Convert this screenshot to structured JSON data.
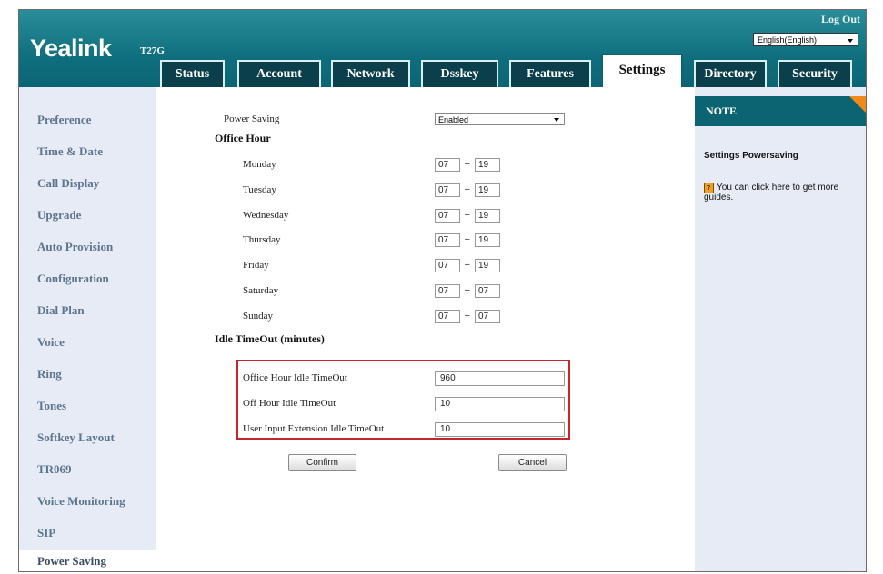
{
  "header": {
    "logo": "Yealink",
    "model": "T27G",
    "logout": "Log Out",
    "language": "English(English)"
  },
  "tabs": [
    {
      "label": "Status"
    },
    {
      "label": "Account"
    },
    {
      "label": "Network"
    },
    {
      "label": "Dsskey"
    },
    {
      "label": "Features"
    },
    {
      "label": "Settings"
    },
    {
      "label": "Directory"
    },
    {
      "label": "Security"
    }
  ],
  "sidebar": {
    "items": [
      {
        "label": "Preference"
      },
      {
        "label": "Time & Date"
      },
      {
        "label": "Call Display"
      },
      {
        "label": "Upgrade"
      },
      {
        "label": "Auto Provision"
      },
      {
        "label": "Configuration"
      },
      {
        "label": "Dial Plan"
      },
      {
        "label": "Voice"
      },
      {
        "label": "Ring"
      },
      {
        "label": "Tones"
      },
      {
        "label": "Softkey Layout"
      },
      {
        "label": "TR069"
      },
      {
        "label": "Voice Monitoring"
      },
      {
        "label": "SIP"
      },
      {
        "label": "Power Saving"
      }
    ]
  },
  "form": {
    "power_saving_label": "Power Saving",
    "power_saving_value": "Enabled",
    "office_hour_heading": "Office Hour",
    "days": [
      {
        "label": "Monday",
        "start": "07",
        "end": "19"
      },
      {
        "label": "Tuesday",
        "start": "07",
        "end": "19"
      },
      {
        "label": "Wednesday",
        "start": "07",
        "end": "19"
      },
      {
        "label": "Thursday",
        "start": "07",
        "end": "19"
      },
      {
        "label": "Friday",
        "start": "07",
        "end": "19"
      },
      {
        "label": "Saturday",
        "start": "07",
        "end": "07"
      },
      {
        "label": "Sunday",
        "start": "07",
        "end": "07"
      }
    ],
    "dash": "–",
    "idle_heading": "Idle TimeOut (minutes)",
    "idle": [
      {
        "label": "Office Hour Idle TimeOut",
        "value": "960"
      },
      {
        "label": "Off Hour Idle TimeOut",
        "value": "10"
      },
      {
        "label": "User Input Extension Idle TimeOut",
        "value": "10"
      }
    ],
    "confirm": "Confirm",
    "cancel": "Cancel"
  },
  "note": {
    "heading": "NOTE",
    "title": "Settings Powersaving",
    "text": "You can click here to get more guides."
  },
  "colors": {
    "header_teal": "#0f6f7e",
    "highlight_red": "#c7252b",
    "note_accent": "#f08a1c"
  }
}
